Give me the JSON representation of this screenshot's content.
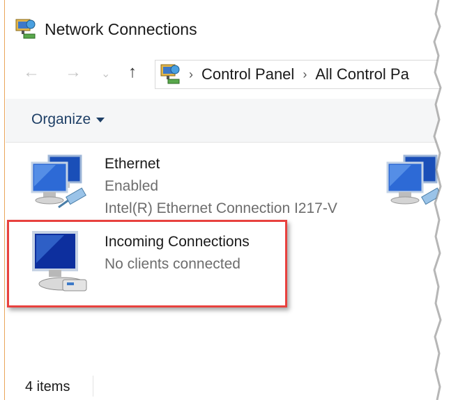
{
  "window": {
    "title": "Network Connections"
  },
  "nav": {
    "back_icon": "back-arrow-icon",
    "forward_icon": "forward-arrow-icon",
    "history_icon": "chevron-down-icon",
    "up_icon": "up-arrow-icon",
    "breadcrumb": [
      "Control Panel",
      "All Control Pa"
    ]
  },
  "toolbar": {
    "organize_label": "Organize"
  },
  "connections": [
    {
      "name": "Ethernet",
      "status": "Enabled",
      "device": "Intel(R) Ethernet Connection I217-V",
      "icon": "ethernet-adapter-icon"
    },
    {
      "name": "",
      "status": "",
      "device": "",
      "icon": "ethernet-adapter-icon"
    },
    {
      "name": "Incoming Connections",
      "status": "No clients connected",
      "icon": "incoming-connections-icon"
    }
  ],
  "status_bar": {
    "item_count": "4 items"
  },
  "colors": {
    "highlight": "#e8413e",
    "command_bar_bg": "#f5f6f7",
    "link_text": "#1e3f66"
  }
}
